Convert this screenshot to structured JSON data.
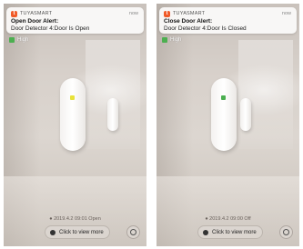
{
  "screens": [
    {
      "notification": {
        "app_name": "TUYASMART",
        "time": "now",
        "title": "Open Door Alert:",
        "body": "Door Detector 4:Door Is Open",
        "app_icon": "tuya-logo-icon"
      },
      "priority": {
        "label": "High",
        "color": "#4caf50"
      },
      "sensor": {
        "led_color": "#e8e23a",
        "state": "open"
      },
      "log": "● 2019.4.2 09:01 Open",
      "view_more": "Click to view more",
      "settings_icon": "settings-icon"
    },
    {
      "notification": {
        "app_name": "TUYASMART",
        "time": "now",
        "title": "Close Door Alert:",
        "body": "Door Detector 4:Door Is Closed",
        "app_icon": "tuya-logo-icon"
      },
      "priority": {
        "label": "High",
        "color": "#4caf50"
      },
      "sensor": {
        "led_color": "#4caf50",
        "state": "closed"
      },
      "log": "● 2019.4.2 09:00 Off",
      "view_more": "Click to view more",
      "settings_icon": "settings-icon"
    }
  ],
  "colors": {
    "accent": "#f05a28"
  }
}
